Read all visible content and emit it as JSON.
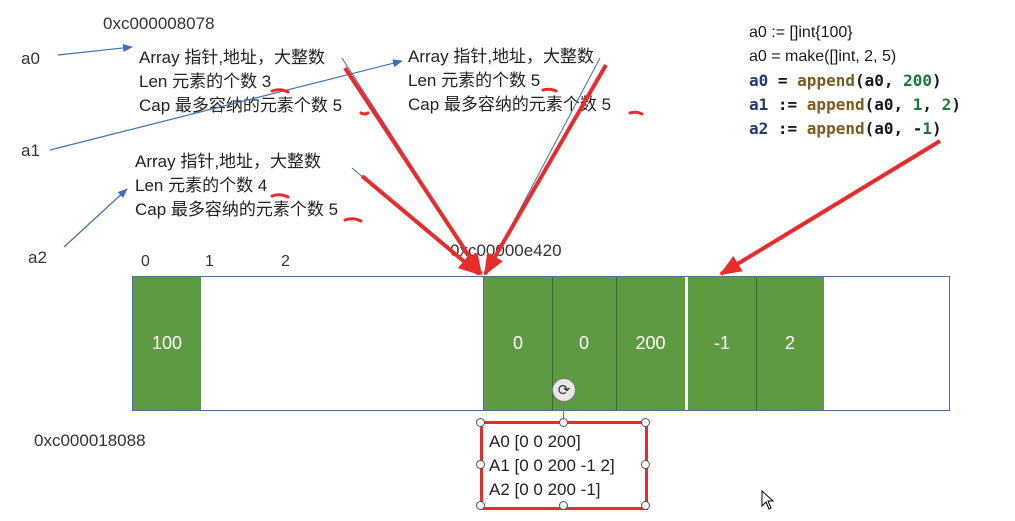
{
  "labels": {
    "addr_top": "0xc000008078",
    "addr_mid": "0xc00000e420",
    "addr_bottom": "0xc000018088",
    "a0": "a0",
    "a1": "a1",
    "a2": "a2",
    "idx0": "0",
    "idx1": "1",
    "idx2": "2"
  },
  "slice_headers": {
    "a0": [
      "Array 指针,地址，大整数",
      "Len 元素的个数 3",
      "Cap 最多容纳的元素个数 5"
    ],
    "a1": [
      "Array 指针,地址，大整数",
      "Len 元素的个数 5",
      "Cap 最多容纳的元素个数 5"
    ],
    "a2": [
      "Array 指针,地址，大整数",
      "Len 元素的个数 4",
      "Cap 最多容纳的元素个数 5"
    ]
  },
  "code": [
    {
      "text": "a0 := []int{100}",
      "style": "plain"
    },
    {
      "text": "a0 = make([]int, 2, 5)",
      "style": "plain"
    },
    {
      "text": "a0 = append(a0, 200)",
      "style": "colored"
    },
    {
      "text": "a1 := append(a0, 1, 2)",
      "style": "colored"
    },
    {
      "text": "a2 := append(a0, -1)",
      "style": "colored"
    }
  ],
  "memory": {
    "first_array": [
      "100",
      "",
      ""
    ],
    "second_array": [
      "0",
      "0",
      "200",
      "-1",
      "2",
      ""
    ]
  },
  "output": [
    "A0 [0 0 200]",
    "A1 [0 0 200 -1 2]",
    "A2 [0 0 200 -1]"
  ],
  "colors": {
    "cell_green": "#5e9a42",
    "red_arrow": "#e82c2c",
    "blue_arrow": "#3f6fb5",
    "code_var": "#1f3a78",
    "code_func": "#7a5c1e",
    "code_num": "#1a7a3a",
    "box_border": "#4a6fa5"
  }
}
